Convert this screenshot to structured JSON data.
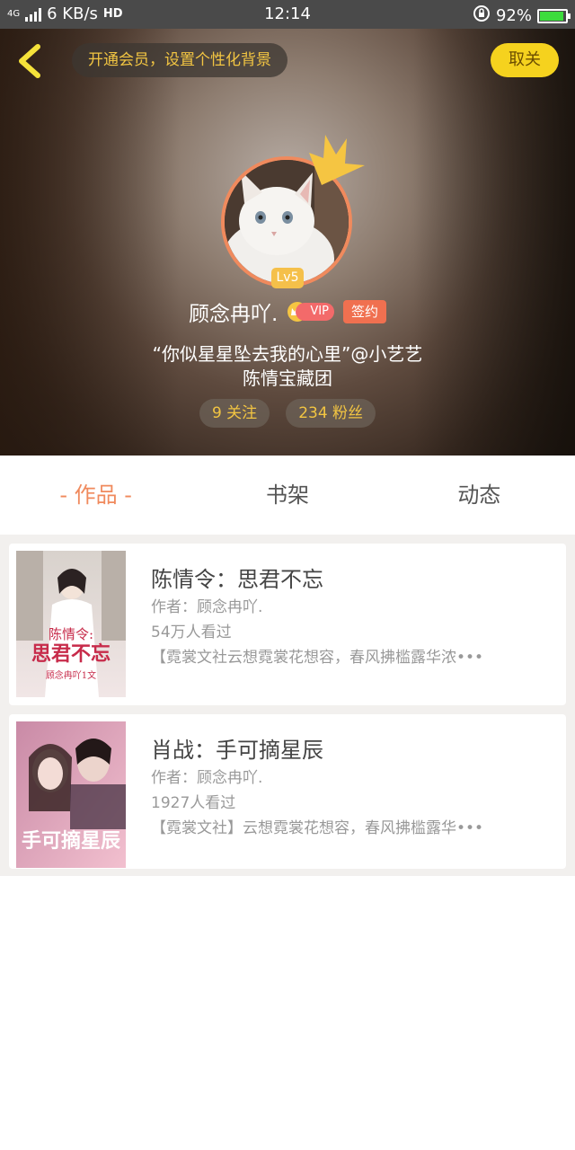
{
  "status_bar": {
    "network": "4G",
    "speed": "6 KB/s",
    "hd": "HD",
    "time": "12:14",
    "battery": "92%",
    "battery_level": 0.92
  },
  "header": {
    "vip_hint": "开通会员，设置个性化背景",
    "unfollow_label": "取关",
    "level": "Lv5",
    "nickname": "顾念冉吖.",
    "vip_label": "VIP",
    "sign_label": "签约",
    "motto": "“你似星星坠去我的心里”@小艺艺",
    "group": "陈情宝藏团",
    "following": "9 关注",
    "followers": "234 粉丝"
  },
  "tabs": [
    {
      "label": "- 作品 -",
      "active": true
    },
    {
      "label": "书架",
      "active": false
    },
    {
      "label": "动态",
      "active": false
    }
  ],
  "works": [
    {
      "title": "陈情令：思君不忘",
      "author": "作者：顾念冉吖.",
      "views": "54万人看过",
      "desc": "【霓裳文社云想霓裳花想容，春风拂槛露华浓•••",
      "cover_title": "陈情令：思君不忘",
      "cover_sub": "顾念冉吖1文"
    },
    {
      "title": "肖战：手可摘星辰",
      "author": "作者：顾念冉吖.",
      "views": "1927人看过",
      "desc": "【霓裳文社】云想霓裳花想容，春风拂槛露华•••",
      "cover_title": "手可摘星辰"
    }
  ],
  "colors": {
    "accent": "#f08a5d",
    "gold": "#f2c542",
    "unfollow_bg": "#f5d21e"
  }
}
